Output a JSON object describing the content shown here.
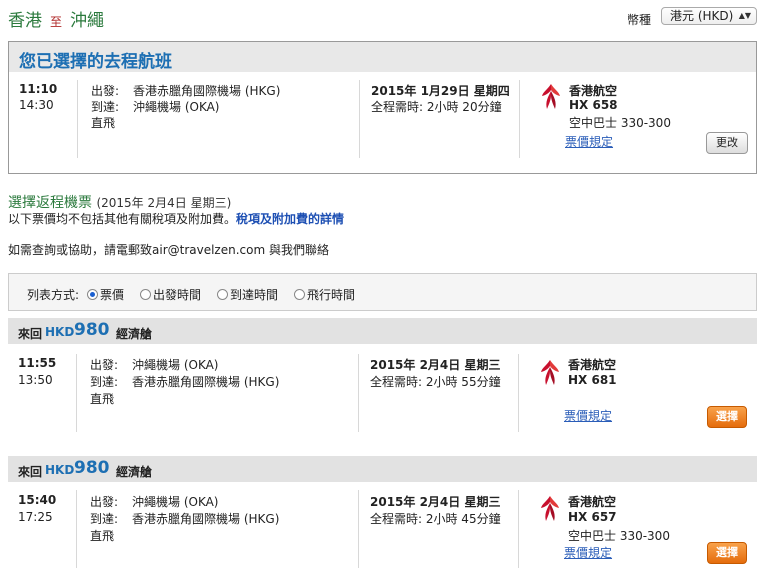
{
  "route": {
    "from": "香港",
    "connector": "至",
    "to": "沖繩"
  },
  "currency": {
    "label": "幣種",
    "selected": "港元 (HKD)"
  },
  "outbound": {
    "title": "您已選擇的去程航班",
    "dep_time": "11:10",
    "arr_time": "14:30",
    "dep_label": "出發:",
    "dep_airport": "香港赤臘角國際機場 (HKG)",
    "arr_label": "到達:",
    "arr_airport": "沖繩機場 (OKA)",
    "nonstop": "直飛",
    "date": "2015年 1月29日 星期四",
    "duration": "全程需時: 2小時 20分鐘",
    "airline": "香港航空",
    "flight": "HX 658",
    "aircraft": "空中巴士 330-300",
    "fare_rules": "票價規定",
    "change_label": "更改"
  },
  "return_section": {
    "title": "選擇返程機票",
    "date": "(2015年 2月4日 星期三)",
    "notice": "以下票價均不包括其他有關稅項及附加費。",
    "notice_link": "稅項及附加費的詳情",
    "contact": "如需查詢或協助，請電郵致air@travelzen.com 與我們聯絡"
  },
  "sort": {
    "label": "列表方式:",
    "options": [
      "票價",
      "出發時間",
      "到達時間",
      "飛行時間"
    ],
    "selected": "票價"
  },
  "fares": [
    {
      "trip": "來回",
      "currency": "HKD",
      "amount": "980",
      "cabin": "經濟艙",
      "dep_time": "11:55",
      "arr_time": "13:50",
      "dep_label": "出發:",
      "dep_airport": "沖繩機場 (OKA)",
      "arr_label": "到達:",
      "arr_airport": "香港赤臘角國際機場 (HKG)",
      "nonstop": "直飛",
      "date": "2015年 2月4日 星期三",
      "duration": "全程需時: 2小時 55分鐘",
      "airline": "香港航空",
      "flight": "HX 681",
      "aircraft": "",
      "fare_rules": "票價規定",
      "select_label": "選擇"
    },
    {
      "trip": "來回",
      "currency": "HKD",
      "amount": "980",
      "cabin": "經濟艙",
      "dep_time": "15:40",
      "arr_time": "17:25",
      "dep_label": "出發:",
      "dep_airport": "沖繩機場 (OKA)",
      "arr_label": "到達:",
      "arr_airport": "香港赤臘角國際機場 (HKG)",
      "nonstop": "直飛",
      "date": "2015年 2月4日 星期三",
      "duration": "全程需時: 2小時 45分鐘",
      "airline": "香港航空",
      "flight": "HX 657",
      "aircraft": "空中巴士 330-300",
      "fare_rules": "票價規定",
      "select_label": "選擇"
    }
  ],
  "icons": {
    "airline_logo": "hong-kong-airlines-bauhinia-logo",
    "select_arrow": "chevron-updown-icon"
  },
  "colors": {
    "accent_blue": "#1d6fb3",
    "route_green": "#2b7a3d",
    "select_orange": "#e56c0c",
    "logo_red": "#c8102e"
  }
}
